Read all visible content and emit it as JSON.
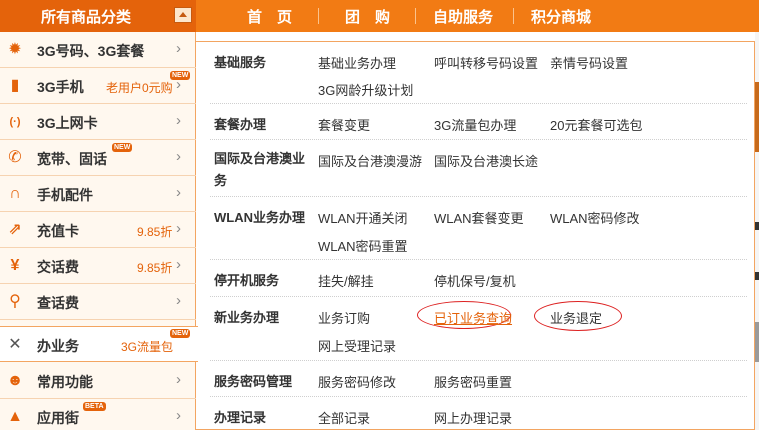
{
  "header": {
    "category_title": "所有商品分类",
    "nav": [
      "首　页",
      "团　购",
      "自助服务",
      "积分商城"
    ]
  },
  "sidebar": {
    "items": [
      {
        "label": "3G号码、3G套餐",
        "extra": "",
        "badge": "",
        "icon": "gear-icon"
      },
      {
        "label": "3G手机",
        "extra": "老用户0元购",
        "badge": "NEW",
        "icon": "phone-icon"
      },
      {
        "label": "3G上网卡",
        "extra": "",
        "badge": "",
        "icon": "wifi-icon"
      },
      {
        "label": "宽带、固话",
        "extra": "",
        "badge": "NEW",
        "icon": "telephone-icon"
      },
      {
        "label": "手机配件",
        "extra": "",
        "badge": "",
        "icon": "headphones-icon"
      },
      {
        "label": "充值卡",
        "extra": "9.85折",
        "badge": "",
        "icon": "card-icon"
      },
      {
        "label": "交话费",
        "extra": "9.85折",
        "badge": "",
        "icon": "yuan-icon"
      },
      {
        "label": "查话费",
        "extra": "",
        "badge": "",
        "icon": "magnifier-icon"
      },
      {
        "label": "办业务",
        "extra": "3G流量包",
        "badge": "NEW",
        "icon": "tools-icon"
      },
      {
        "label": "常用功能",
        "extra": "",
        "badge": "",
        "icon": "user-group-icon"
      },
      {
        "label": "应用街",
        "extra": "",
        "badge": "BETA",
        "icon": "bag-icon"
      }
    ],
    "arrow": "›"
  },
  "panel": {
    "rows": [
      {
        "category": "基础服务",
        "links": [
          "基础业务办理",
          "呼叫转移号码设置",
          "亲情号码设置",
          "3G网龄升级计划"
        ]
      },
      {
        "category": "套餐办理",
        "links": [
          "套餐变更",
          "3G流量包办理",
          "20元套餐可选包"
        ]
      },
      {
        "category": "国际及台港澳业务",
        "links": [
          "国际及台港澳漫游",
          "国际及台港澳长途"
        ]
      },
      {
        "category": "WLAN业务办理",
        "links": [
          "WLAN开通关闭",
          "WLAN套餐变更",
          "WLAN密码修改",
          "WLAN密码重置"
        ]
      },
      {
        "category": "停开机服务",
        "links": [
          "挂失/解挂",
          "停机保号/复机"
        ]
      },
      {
        "category": "新业务办理",
        "links": [
          "业务订购",
          "已订业务查询",
          "业务退定",
          "网上受理记录"
        ]
      },
      {
        "category": "服务密码管理",
        "links": [
          "服务密码修改",
          "服务密码重置"
        ]
      },
      {
        "category": "办理记录",
        "links": [
          "全部记录",
          "网上办理记录"
        ]
      }
    ]
  },
  "colors": {
    "accent": "#f27b14",
    "dark_accent": "#e4630b",
    "highlight_ring": "#dd2222"
  }
}
